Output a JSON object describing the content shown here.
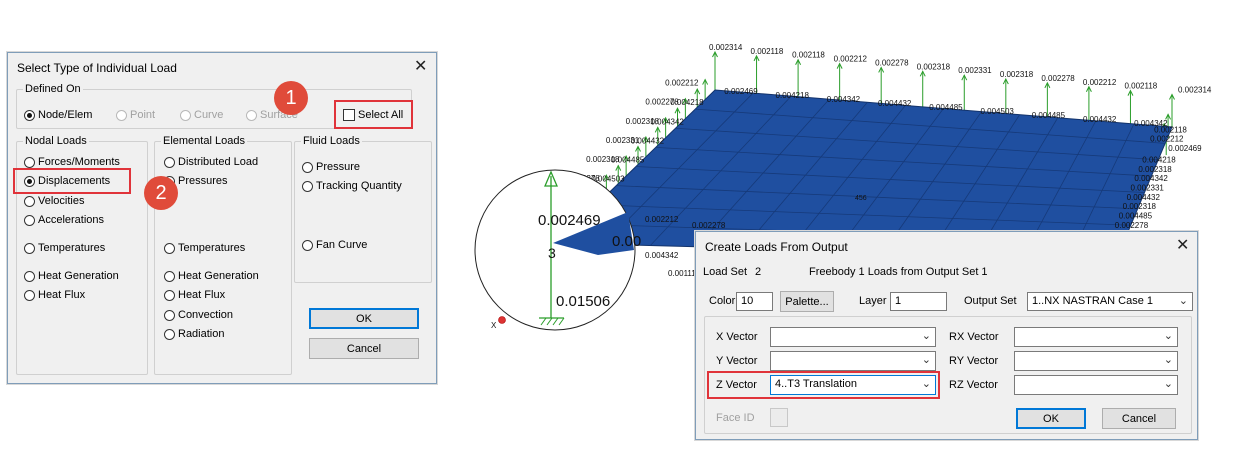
{
  "dialog1": {
    "title": "Select Type of Individual Load",
    "defined_on": {
      "legend": "Defined On",
      "options": [
        "Node/Elem",
        "Point",
        "Curve",
        "Surface"
      ]
    },
    "select_all_label": "Select All",
    "nodal": {
      "legend": "Nodal Loads",
      "items": [
        "Forces/Moments",
        "Displacements",
        "Velocities",
        "Accelerations",
        "Temperatures",
        "Heat Generation",
        "Heat Flux"
      ]
    },
    "elemental": {
      "legend": "Elemental Loads",
      "items": [
        "Distributed Load",
        "Pressures",
        "Temperatures",
        "Heat Generation",
        "Heat Flux",
        "Convection",
        "Radiation"
      ]
    },
    "fluid": {
      "legend": "Fluid Loads",
      "items": [
        "Pressure",
        "Tracking Quantity",
        "Fan Curve"
      ]
    },
    "ok_label": "OK",
    "cancel_label": "Cancel"
  },
  "badges": [
    "1",
    "2",
    "3"
  ],
  "model": {
    "top_labels": [
      "0.002314",
      "0.002118",
      "0.002118",
      "0.002212",
      "0.002278",
      "0.002318",
      "0.002331",
      "0.002318",
      "0.002278",
      "0.002212",
      "0.002118",
      "0.002314"
    ],
    "left_labels": [
      "0.002212",
      "0.004218",
      "0.002278",
      "0.004342",
      "0.002318",
      "0.004432",
      "0.002331",
      "0.004485",
      "0.002318",
      "0.004503",
      "0.002278",
      "0.004485",
      "0.002212",
      "0.004342"
    ],
    "inner_labels": [
      "0.002469",
      "0.004218",
      "0.004342",
      "0.004432",
      "0.004485",
      "0.004503",
      "0.004485",
      "0.004432",
      "0.004342"
    ],
    "right_labels": [
      "0.002118",
      "0.002212",
      "0.002469",
      "0.004218",
      "0.002318",
      "0.004342",
      "0.002331",
      "0.004432",
      "0.002318",
      "0.004485",
      "0.002278",
      "0.004503",
      "0.002212"
    ],
    "bottom_labels": [
      "0.002212",
      "0.002278",
      "0.004342",
      "0.00111"
    ],
    "center_node": "456",
    "zoom_value_top": "0.002469",
    "zoom_node": "3",
    "zoom_value_bottom": "0.01506",
    "zoom_partial": "0.00",
    "axis_label": "X",
    "colors": {
      "plate": "#1f4fa0",
      "arrow": "#2a9d2a",
      "highlight": "#e0333a",
      "badge": "#e04b3a"
    }
  },
  "dialog2": {
    "title": "Create Loads From Output",
    "load_set_label": "Load Set",
    "load_set_value": "2",
    "freebody_text": "Freebody 1 Loads from Output Set 1",
    "color_label": "Color",
    "color_value": "10",
    "palette_label": "Palette...",
    "layer_label": "Layer",
    "layer_value": "1",
    "output_set_label": "Output Set",
    "output_set_value": "1..NX NASTRAN Case 1",
    "x_vector_label": "X Vector",
    "x_vector_value": "",
    "y_vector_label": "Y Vector",
    "y_vector_value": "",
    "z_vector_label": "Z Vector",
    "z_vector_value": "4..T3 Translation",
    "rx_vector_label": "RX Vector",
    "rx_vector_value": "",
    "ry_vector_label": "RY Vector",
    "ry_vector_value": "",
    "rz_vector_label": "RZ Vector",
    "rz_vector_value": "",
    "face_id_label": "Face ID",
    "ok_label": "OK",
    "cancel_label": "Cancel"
  }
}
